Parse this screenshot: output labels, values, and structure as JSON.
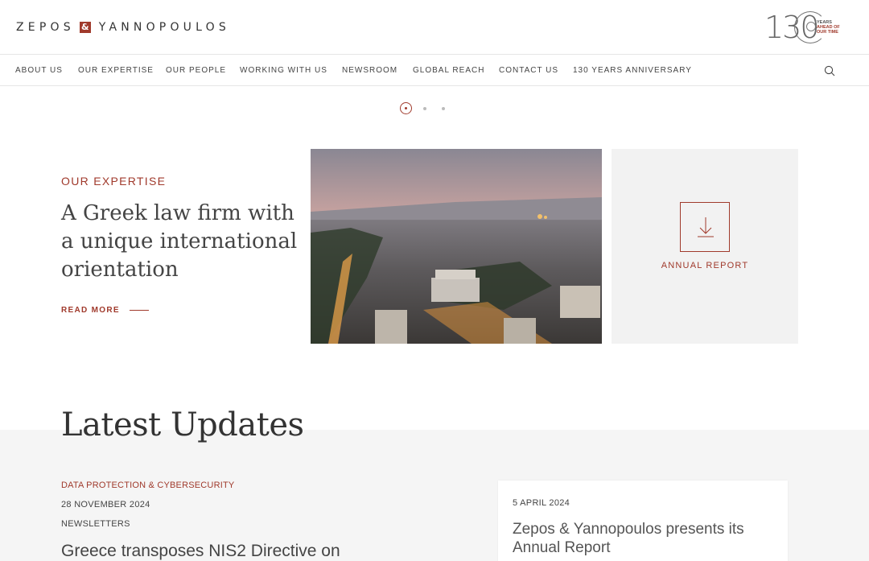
{
  "header": {
    "logo_left": "ZEPOS",
    "logo_amp": "&",
    "logo_right": "YANNOPOULOS",
    "anniversary_number": "130",
    "anniversary_line1": "YEARS",
    "anniversary_line2": "AHEAD OF",
    "anniversary_line3": "OUR TIME"
  },
  "nav": {
    "items": [
      "ABOUT US",
      "OUR EXPERTISE",
      "OUR PEOPLE",
      "WORKING WITH US",
      "NEWSROOM",
      "GLOBAL REACH",
      "CONTACT US",
      "130 YEARS ANNIVERSARY"
    ]
  },
  "hero": {
    "eyebrow": "OUR EXPERTISE",
    "title": "A Greek law firm with a unique international orientation",
    "read_more": "READ MORE",
    "report_label": "ANNUAL REPORT"
  },
  "updates": {
    "title": "Latest Updates",
    "featured": {
      "category": "DATA PROTECTION & CYBERSECURITY",
      "date": "28 NOVEMBER 2024",
      "type": "NEWSLETTERS",
      "title": "Greece transposes NIS2 Directive on"
    },
    "card": {
      "date": "5 APRIL 2024",
      "title": "Zepos & Yannopoulos presents its Annual Report"
    }
  },
  "colors": {
    "accent": "#a03a2c",
    "text": "#444444",
    "panel": "#f2f2f2"
  },
  "icons": [
    "search-icon",
    "download-icon",
    "slider-dot-icon"
  ]
}
